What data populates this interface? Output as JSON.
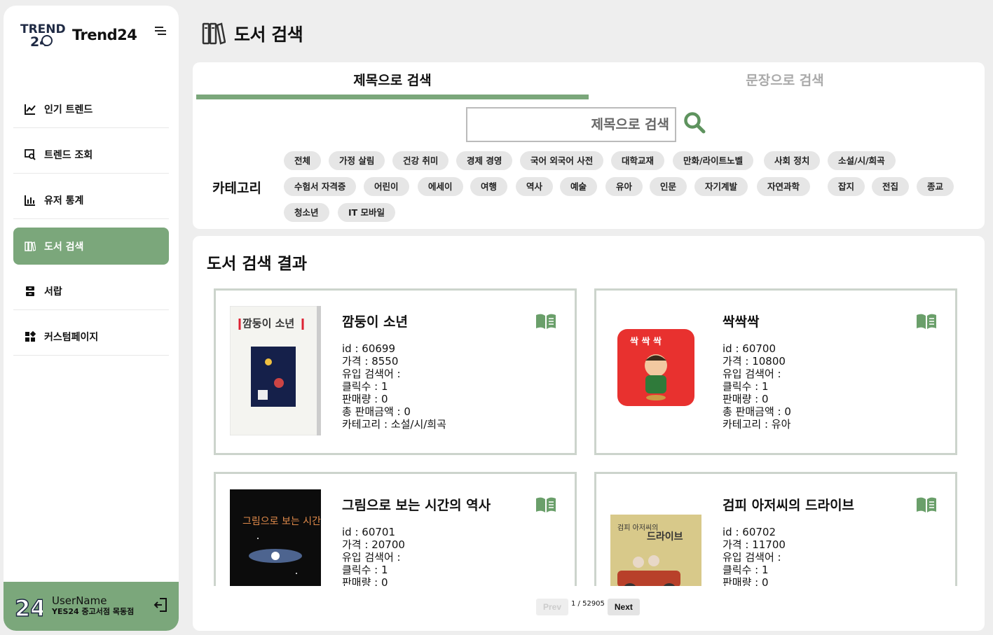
{
  "app": {
    "brand_name": "Trend24",
    "logo_text": "TREND 24"
  },
  "nav": {
    "items": [
      {
        "label": "인기 트렌드",
        "icon": "line-chart-icon"
      },
      {
        "label": "트렌드 조회",
        "icon": "search-window-icon"
      },
      {
        "label": "유저 통계",
        "icon": "bar-chart-icon"
      },
      {
        "label": "도서 검색",
        "icon": "books-icon",
        "active": true
      },
      {
        "label": "서랍",
        "icon": "drawer-icon"
      },
      {
        "label": "커스텀페이지",
        "icon": "widgets-icon"
      }
    ]
  },
  "user": {
    "name": "UserName",
    "shop": "YES24 중고서점 목동점"
  },
  "header": {
    "title": "도서 검색"
  },
  "search": {
    "tabs": [
      {
        "label": "제목으로 검색",
        "active": true
      },
      {
        "label": "문장으로 검색",
        "active": false
      }
    ],
    "placeholder": "제목으로 검색",
    "category_label": "카테고리",
    "categories": [
      "전체",
      "가정 살림",
      "건강 취미",
      "경제 경영",
      "국어 외국어 사전",
      "대학교재",
      "만화/라이트노벨",
      "사회 정치",
      "소설/시/희곡",
      "수험서 자격증",
      "어린이",
      "에세이",
      "여행",
      "역사",
      "예술",
      "유아",
      "인문",
      "자기계발",
      "자연과학",
      "잡지",
      "전집",
      "종교",
      "청소년",
      "IT 모바일"
    ]
  },
  "results": {
    "title": "도서 검색 결과",
    "field_labels": {
      "id": "id : ",
      "price": "가격 : ",
      "keyword": "유입 검색어 : ",
      "clicks": "클릭수 : ",
      "sales": "판매량 : ",
      "revenue": "총 판매금액 : ",
      "category": "카테고리 : "
    },
    "books": [
      {
        "title": "깜둥이 소년",
        "id": "60699",
        "price": "8550",
        "keyword": "",
        "clicks": "1",
        "sales": "0",
        "revenue": "0",
        "category": "소설/시/희곡",
        "cover_text": "깜둥이 소년",
        "cover_color": "#f4f4f0"
      },
      {
        "title": "싹싹싹",
        "id": "60700",
        "price": "10800",
        "keyword": "",
        "clicks": "1",
        "sales": "0",
        "revenue": "0",
        "category": "유아",
        "cover_text": "싹 싹 싹",
        "cover_color": "#e8312f"
      },
      {
        "title": "그림으로 보는 시간의 역사",
        "id": "60701",
        "price": "20700",
        "keyword": "",
        "clicks": "1",
        "sales": "0",
        "revenue": "",
        "category": "",
        "cover_text": "그림으로 보는 시간의 역사",
        "cover_color": "#0c0c0c"
      },
      {
        "title": "검피 아저씨의 드라이브",
        "id": "60702",
        "price": "11700",
        "keyword": "",
        "clicks": "1",
        "sales": "0",
        "revenue": "",
        "category": "",
        "cover_text": "검피 아저씨의 드라이브",
        "cover_color": "#d8c98a"
      }
    ]
  },
  "pager": {
    "prev": "Prev",
    "next": "Next",
    "info": "1 / 52905"
  },
  "colors": {
    "accent": "#7ba77b",
    "background": "#eeeeee"
  }
}
